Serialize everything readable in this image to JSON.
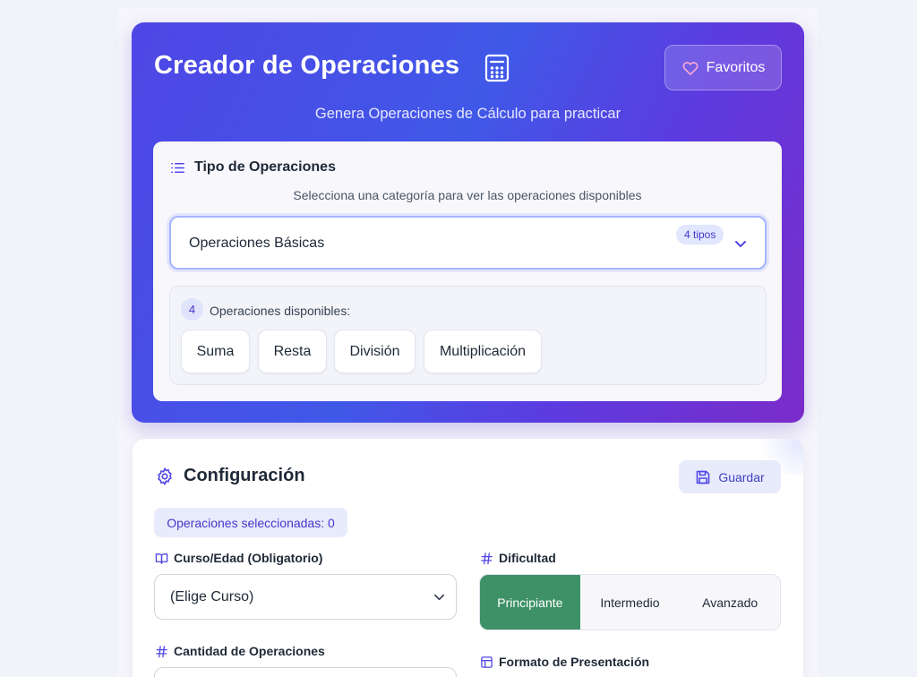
{
  "header": {
    "title": "Creador de Operaciones",
    "title_icon": "calculator-icon",
    "subtitle": "Genera Operaciones de Cálculo para practicar",
    "favorites_label": "Favoritos",
    "favorites_icon": "heart-icon"
  },
  "operation_type": {
    "heading": "Tipo de Operaciones",
    "heading_icon": "list-icon",
    "description": "Selecciona una categoría para ver las operaciones disponibles",
    "selected_category": "Operaciones Básicas",
    "category_badge": "4 tipos",
    "available_count": "4",
    "available_label": "Operaciones disponibles:",
    "operations": [
      "Suma",
      "Resta",
      "División",
      "Multiplicación"
    ]
  },
  "config": {
    "heading": "Configuración",
    "heading_icon": "gear-icon",
    "save_label": "Guardar",
    "save_icon": "floppy-disk-icon",
    "selected_ops_label": "Operaciones seleccionadas: 0",
    "course_label": "Curso/Edad (Obligatorio)",
    "course_value": "(Elige Curso)",
    "difficulty_label": "Dificultad",
    "difficulty_options": [
      "Principiante",
      "Intermedio",
      "Avanzado"
    ],
    "difficulty_selected": "Principiante",
    "quantity_label": "Cantidad de Operaciones",
    "format_label": "Formato de Presentación"
  },
  "colors": {
    "hero_start": "#4f46e5",
    "hero_end": "#7b2cc9",
    "accent": "#4338ca",
    "difficulty_active": "#3e9167"
  }
}
